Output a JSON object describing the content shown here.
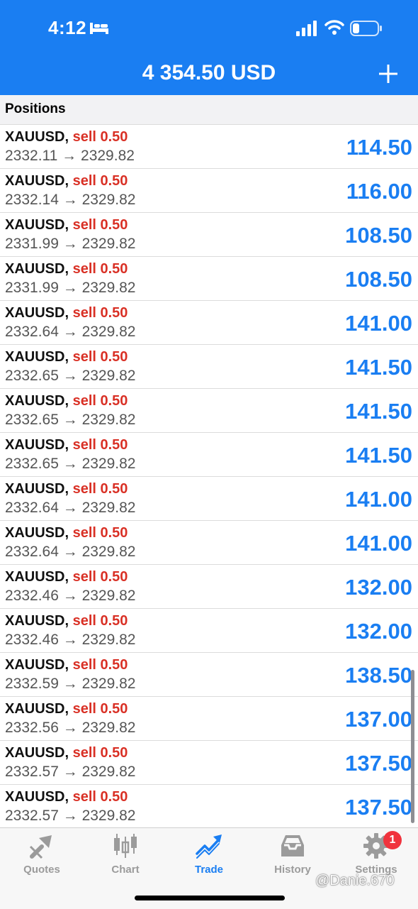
{
  "status_bar": {
    "time": "4:12",
    "icons": [
      "bed-icon",
      "signal-icon",
      "wifi-icon",
      "battery-icon"
    ]
  },
  "header": {
    "balance": "4 354.50 USD",
    "add_icon": "plus-icon"
  },
  "section": {
    "title": "Positions"
  },
  "positions": [
    {
      "symbol": "XAUUSD,",
      "side": "sell 0.50",
      "prices": "2332.11 → 2329.82",
      "profit": "114.50"
    },
    {
      "symbol": "XAUUSD,",
      "side": "sell 0.50",
      "prices": "2332.14 → 2329.82",
      "profit": "116.00"
    },
    {
      "symbol": "XAUUSD,",
      "side": "sell 0.50",
      "prices": "2331.99 → 2329.82",
      "profit": "108.50"
    },
    {
      "symbol": "XAUUSD,",
      "side": "sell 0.50",
      "prices": "2331.99 → 2329.82",
      "profit": "108.50"
    },
    {
      "symbol": "XAUUSD,",
      "side": "sell 0.50",
      "prices": "2332.64 → 2329.82",
      "profit": "141.00"
    },
    {
      "symbol": "XAUUSD,",
      "side": "sell 0.50",
      "prices": "2332.65 → 2329.82",
      "profit": "141.50"
    },
    {
      "symbol": "XAUUSD,",
      "side": "sell 0.50",
      "prices": "2332.65 → 2329.82",
      "profit": "141.50"
    },
    {
      "symbol": "XAUUSD,",
      "side": "sell 0.50",
      "prices": "2332.65 → 2329.82",
      "profit": "141.50"
    },
    {
      "symbol": "XAUUSD,",
      "side": "sell 0.50",
      "prices": "2332.64 → 2329.82",
      "profit": "141.00"
    },
    {
      "symbol": "XAUUSD,",
      "side": "sell 0.50",
      "prices": "2332.64 → 2329.82",
      "profit": "141.00"
    },
    {
      "symbol": "XAUUSD,",
      "side": "sell 0.50",
      "prices": "2332.46 → 2329.82",
      "profit": "132.00"
    },
    {
      "symbol": "XAUUSD,",
      "side": "sell 0.50",
      "prices": "2332.46 → 2329.82",
      "profit": "132.00"
    },
    {
      "symbol": "XAUUSD,",
      "side": "sell 0.50",
      "prices": "2332.59 → 2329.82",
      "profit": "138.50"
    },
    {
      "symbol": "XAUUSD,",
      "side": "sell 0.50",
      "prices": "2332.56 → 2329.82",
      "profit": "137.00"
    },
    {
      "symbol": "XAUUSD,",
      "side": "sell 0.50",
      "prices": "2332.57 → 2329.82",
      "profit": "137.50"
    },
    {
      "symbol": "XAUUSD,",
      "side": "sell 0.50",
      "prices": "2332.57 → 2329.82",
      "profit": "137.50"
    }
  ],
  "tabs": [
    {
      "label": "Quotes",
      "icon": "quotes-icon",
      "active": false
    },
    {
      "label": "Chart",
      "icon": "chart-icon",
      "active": false
    },
    {
      "label": "Trade",
      "icon": "trade-icon",
      "active": true
    },
    {
      "label": "History",
      "icon": "history-icon",
      "active": false
    },
    {
      "label": "Settings",
      "icon": "settings-icon",
      "active": false
    }
  ],
  "settings_badge": "1",
  "watermark": "@Danie.670",
  "colors": {
    "accent": "#1a7ef2",
    "sell": "#d93025",
    "inactive": "#9b9b9b",
    "badge": "#f0333d"
  }
}
